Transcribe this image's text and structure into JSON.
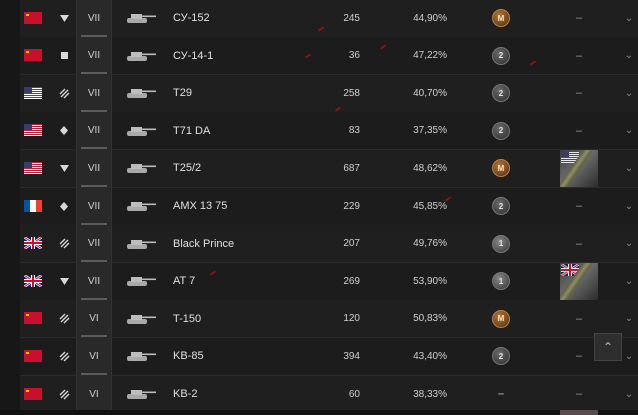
{
  "colors": {
    "background": "#171717",
    "row": "#1f1f1f",
    "tier_bg": "#292929",
    "mastery_master": "#b5773a",
    "accent_red": "#8b1515"
  },
  "dash": "–",
  "rows": [
    {
      "nation": "ussr",
      "role": "td",
      "tier": "VII",
      "tank_icon": "tank-silhouette-icon",
      "name": "СУ-152",
      "battles": "245",
      "winrate": "44,90%",
      "mastery": "M",
      "mastery_kind": "m",
      "camo": "–",
      "camo_flag": ""
    },
    {
      "nation": "ussr",
      "role": "spg",
      "tier": "VII",
      "tank_icon": "tank-silhouette-icon",
      "name": "СУ-14-1",
      "battles": "36",
      "winrate": "47,22%",
      "mastery": "2",
      "mastery_kind": "b2",
      "camo": "–",
      "camo_flag": ""
    },
    {
      "nation": "usa",
      "role": "heavy",
      "tier": "VII",
      "tank_icon": "tank-silhouette-icon",
      "name": "T29",
      "battles": "258",
      "winrate": "40,70%",
      "mastery": "2",
      "mastery_kind": "b2",
      "camo": "–",
      "camo_flag": ""
    },
    {
      "nation": "usa",
      "role": "light",
      "tier": "VII",
      "tank_icon": "tank-silhouette-icon",
      "name": "T71 DA",
      "battles": "83",
      "winrate": "37,35%",
      "mastery": "2",
      "mastery_kind": "b2",
      "camo": "–",
      "camo_flag": ""
    },
    {
      "nation": "usa",
      "role": "td",
      "tier": "VII",
      "tank_icon": "tank-silhouette-icon",
      "name": "T25/2",
      "battles": "687",
      "winrate": "48,62%",
      "mastery": "M",
      "mastery_kind": "m",
      "camo": "",
      "camo_flag": "usa"
    },
    {
      "nation": "france",
      "role": "light",
      "tier": "VII",
      "tank_icon": "tank-silhouette-icon",
      "name": "AMX 13 75",
      "battles": "229",
      "winrate": "45,85%",
      "mastery": "2",
      "mastery_kind": "b2",
      "camo": "–",
      "camo_flag": ""
    },
    {
      "nation": "uk",
      "role": "heavy",
      "tier": "VII",
      "tank_icon": "tank-silhouette-icon",
      "name": "Black Prince",
      "battles": "207",
      "winrate": "49,76%",
      "mastery": "1",
      "mastery_kind": "b1",
      "camo": "–",
      "camo_flag": ""
    },
    {
      "nation": "uk",
      "role": "td",
      "tier": "VII",
      "tank_icon": "tank-silhouette-icon",
      "name": "AT 7",
      "battles": "269",
      "winrate": "53,90%",
      "mastery": "1",
      "mastery_kind": "b1",
      "camo": "",
      "camo_flag": "uk"
    },
    {
      "nation": "ussr",
      "role": "heavy",
      "tier": "VI",
      "tank_icon": "tank-silhouette-icon",
      "name": "T-150",
      "battles": "120",
      "winrate": "50,83%",
      "mastery": "M",
      "mastery_kind": "m",
      "camo": "–",
      "camo_flag": ""
    },
    {
      "nation": "ussr",
      "role": "heavy",
      "tier": "VI",
      "tank_icon": "tank-silhouette-icon",
      "name": "KB-85",
      "battles": "394",
      "winrate": "43,40%",
      "mastery": "2",
      "mastery_kind": "b2",
      "camo": "–",
      "camo_flag": ""
    },
    {
      "nation": "ussr",
      "role": "heavy",
      "tier": "VI",
      "tank_icon": "tank-silhouette-icon",
      "name": "KB-2",
      "battles": "60",
      "winrate": "38,33%",
      "mastery": "–",
      "mastery_kind": "dash",
      "camo": "–",
      "camo_flag": ""
    }
  ],
  "scroll_top_label": "⌃"
}
